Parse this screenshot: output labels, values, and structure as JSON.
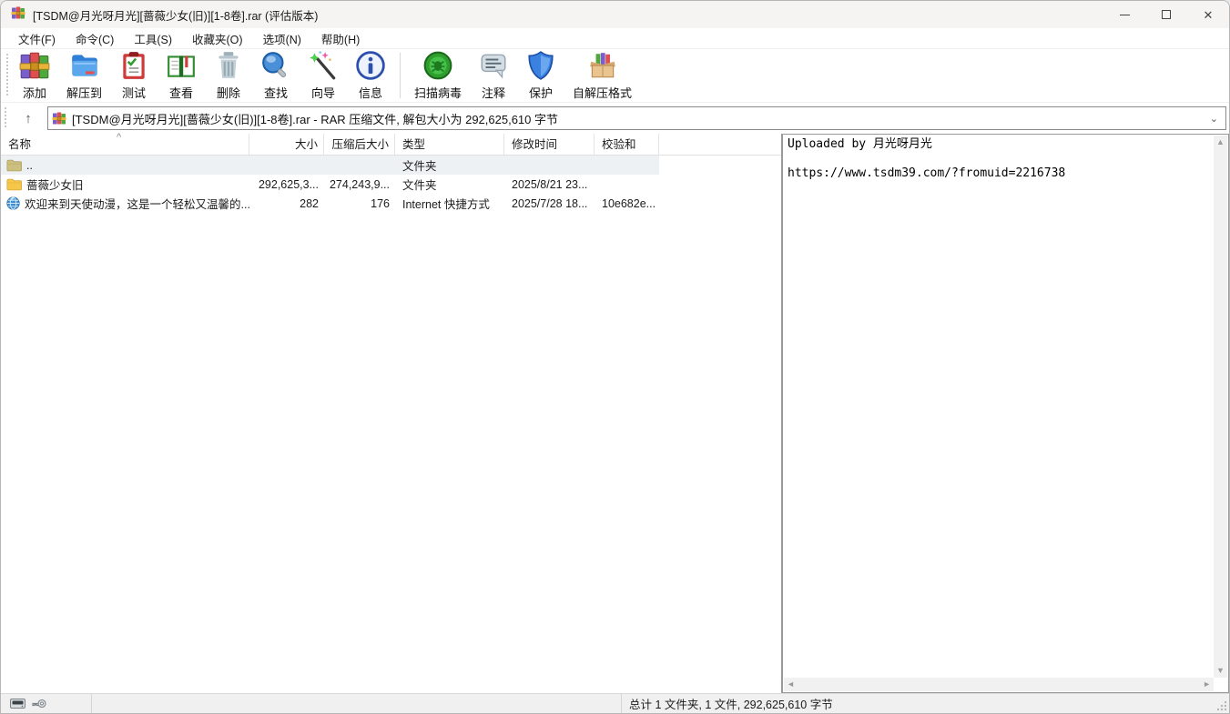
{
  "window": {
    "title": "[TSDM@月光呀月光][蔷薇少女(旧)][1-8卷].rar (评估版本)"
  },
  "menubar": {
    "items": [
      {
        "label": "文件(F)"
      },
      {
        "label": "命令(C)"
      },
      {
        "label": "工具(S)"
      },
      {
        "label": "收藏夹(O)"
      },
      {
        "label": "选项(N)"
      },
      {
        "label": "帮助(H)"
      }
    ]
  },
  "toolbar": {
    "buttons": [
      {
        "label": "添加",
        "icon": "winrar-add-icon"
      },
      {
        "label": "解压到",
        "icon": "extract-folder-icon"
      },
      {
        "label": "测试",
        "icon": "test-clipboard-icon"
      },
      {
        "label": "查看",
        "icon": "view-book-icon"
      },
      {
        "label": "删除",
        "icon": "delete-trash-icon"
      },
      {
        "label": "查找",
        "icon": "find-magnifier-icon"
      },
      {
        "label": "向导",
        "icon": "wizard-wand-icon"
      },
      {
        "label": "信息",
        "icon": "info-circle-icon"
      },
      {
        "label": "扫描病毒",
        "icon": "virus-scan-icon"
      },
      {
        "label": "注释",
        "icon": "comment-bubble-icon"
      },
      {
        "label": "保护",
        "icon": "protect-shield-icon"
      },
      {
        "label": "自解压格式",
        "icon": "sfx-box-icon"
      }
    ]
  },
  "addressbar": {
    "text": "[TSDM@月光呀月光][蔷薇少女(旧)][1-8卷].rar - RAR 压缩文件, 解包大小为 292,625,610 字节",
    "up_glyph": "↑",
    "chevron_glyph": "⌄"
  },
  "filelist": {
    "columns": [
      {
        "label": "名称"
      },
      {
        "label": "大小"
      },
      {
        "label": "压缩后大小"
      },
      {
        "label": "类型"
      },
      {
        "label": "修改时间"
      },
      {
        "label": "校验和"
      }
    ],
    "sort_caret": "^",
    "rows": [
      {
        "name": "..",
        "size": "",
        "packed": "",
        "type": "文件夹",
        "modified": "",
        "checksum": "",
        "icon": "folder-up-icon"
      },
      {
        "name": "蔷薇少女旧",
        "size": "292,625,3...",
        "packed": "274,243,9...",
        "type": "文件夹",
        "modified": "2025/8/21 23...",
        "checksum": "",
        "icon": "folder-icon"
      },
      {
        "name": "欢迎来到天使动漫，这是一个轻松又温馨的...",
        "size": "282",
        "packed": "176",
        "type": "Internet 快捷方式",
        "modified": "2025/7/28 18...",
        "checksum": "10e682e...",
        "icon": "globe-icon"
      }
    ]
  },
  "comment": {
    "text": "Uploaded by 月光呀月光\n\nhttps://www.tsdm39.com/?fromuid=2216738"
  },
  "scrollbars": {
    "up": "▲",
    "down": "▼",
    "left": "◄",
    "right": "►"
  },
  "statusbar": {
    "total": "总计 1 文件夹, 1 文件, 292,625,610 字节"
  },
  "colors": {
    "accent_folder": "#f0c75a",
    "highlight_row": "#eef1f4",
    "titlebar_bg": "#f5f4f2",
    "statusbar_bg": "#f0f0f0"
  }
}
